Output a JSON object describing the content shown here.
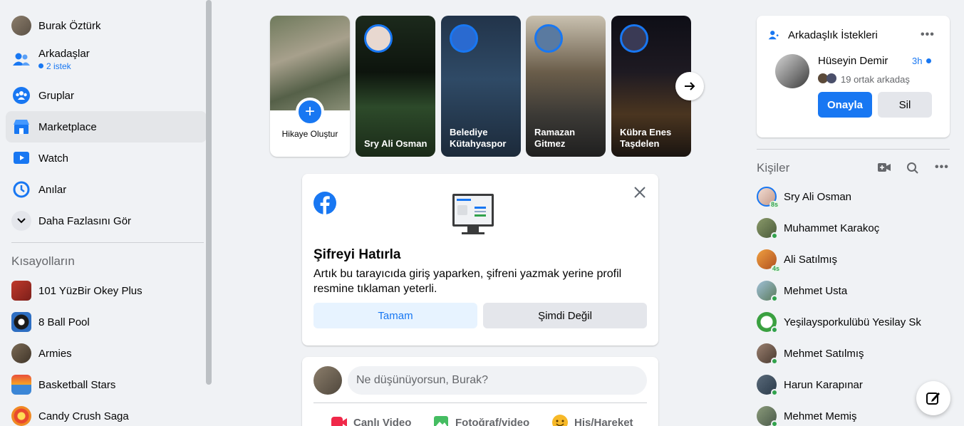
{
  "sidebar": {
    "profile_name": "Burak Öztürk",
    "items": [
      {
        "label": "Arkadaşlar",
        "sub": "2 istek"
      },
      {
        "label": "Gruplar"
      },
      {
        "label": "Marketplace"
      },
      {
        "label": "Watch"
      },
      {
        "label": "Anılar"
      },
      {
        "label": "Daha Fazlasını Gör"
      }
    ],
    "shortcuts_title": "Kısayolların",
    "shortcuts": [
      "101 YüzBir Okey Plus",
      "8 Ball Pool",
      "Armies",
      "Basketball Stars",
      "Candy Crush Saga"
    ]
  },
  "stories": {
    "create_label": "Hikaye Oluştur",
    "items": [
      {
        "name": "Sry Ali Osman"
      },
      {
        "name": "Belediye Kütahyaspor"
      },
      {
        "name": "Ramazan Gitmez"
      },
      {
        "name": "Kübra Enes Taşdelen"
      }
    ]
  },
  "password_card": {
    "title": "Şifreyi Hatırla",
    "text": "Artık bu tarayıcıda giriş yaparken, şifreni yazmak yerine profil resmine tıklaman yeterli.",
    "ok_label": "Tamam",
    "not_now_label": "Şimdi Değil"
  },
  "composer": {
    "placeholder": "Ne düşünüyorsun, Burak?",
    "actions": [
      "Canlı Video",
      "Fotoğraf/video",
      "His/Hareket"
    ]
  },
  "friend_requests": {
    "title": "Arkadaşlık İstekleri",
    "name": "Hüseyin Demir",
    "time": "3h",
    "mutual": "19 ortak arkadaş",
    "accept_label": "Onayla",
    "delete_label": "Sil"
  },
  "contacts": {
    "title": "Kişiler",
    "items": [
      {
        "name": "Sry Ali Osman",
        "badge": "8s"
      },
      {
        "name": "Muhammet Karakoç",
        "badge": ""
      },
      {
        "name": "Ali Satılmış",
        "badge": "4s"
      },
      {
        "name": "Mehmet Usta",
        "badge": ""
      },
      {
        "name": "Yeşilaysporkulübü Yesilay Sk",
        "badge": ""
      },
      {
        "name": "Mehmet Satılmış",
        "badge": ""
      },
      {
        "name": "Harun Karapınar",
        "badge": ""
      },
      {
        "name": "Mehmet Memiş",
        "badge": ""
      }
    ]
  },
  "colors": {
    "accent": "#1877f2",
    "background": "#f0f2f5",
    "online": "#31a24c"
  }
}
